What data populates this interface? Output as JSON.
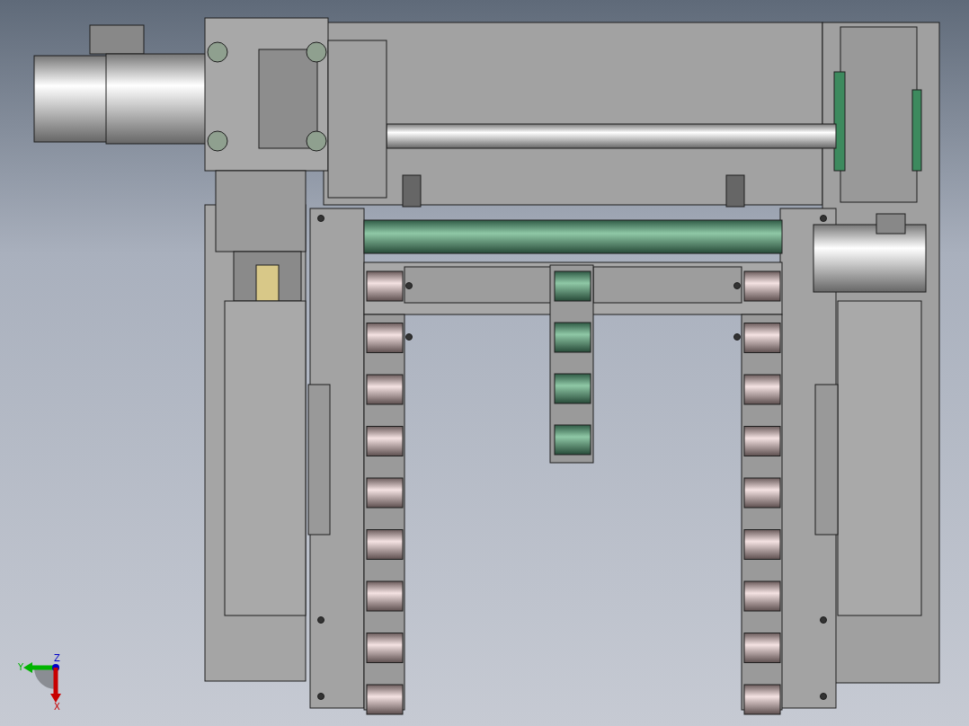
{
  "viewport": {
    "triad": {
      "axes": [
        {
          "label": "Y",
          "color": "#00b400"
        },
        {
          "label": "Z",
          "color": "#0000c8"
        },
        {
          "label": "X",
          "color": "#c80000"
        }
      ]
    }
  }
}
